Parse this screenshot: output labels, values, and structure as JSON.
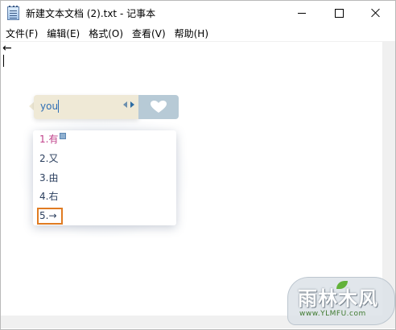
{
  "window": {
    "title": "新建文本文档 (2).txt - 记事本"
  },
  "menu": [
    "文件(F)",
    "编辑(E)",
    "格式(O)",
    "查看(V)",
    "帮助(H)"
  ],
  "editor": {
    "content": "←"
  },
  "ime": {
    "composition": "you",
    "candidates": [
      "1.有",
      "2.又",
      "3.由",
      "4.右",
      "5.→"
    ],
    "highlighted_index": 5,
    "accent_color": "#e07b22"
  },
  "watermark": {
    "title": "雨林木风",
    "url": "www.YLMFU.com"
  }
}
